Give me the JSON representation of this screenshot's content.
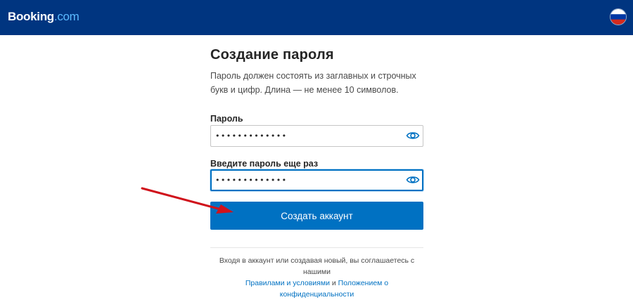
{
  "header": {
    "logo_brand": "Booking",
    "logo_tld": ".com",
    "language_flag": "russia-flag-icon"
  },
  "form": {
    "title": "Создание пароля",
    "description": "Пароль должен состоять из заглавных и строчных букв и цифр. Длина — не менее 10 символов.",
    "password_label": "Пароль",
    "password_value": "•••••••••••••",
    "confirm_label": "Введите пароль еще раз",
    "confirm_value": "•••••••••••••",
    "submit_label": "Создать аккаунт"
  },
  "terms": {
    "text_before": "Входя в аккаунт или создавая новый, вы соглашаетесь с нашими",
    "terms_link": "Правилами и условиями",
    "conjunction": "и",
    "privacy_link": "Положением о конфиденциальности"
  },
  "colors": {
    "header_bg": "#003580",
    "accent": "#0071c2",
    "annotation_arrow": "#d0121b"
  },
  "icons": {
    "show_password": "eye-icon",
    "annotation": "arrow-icon"
  }
}
